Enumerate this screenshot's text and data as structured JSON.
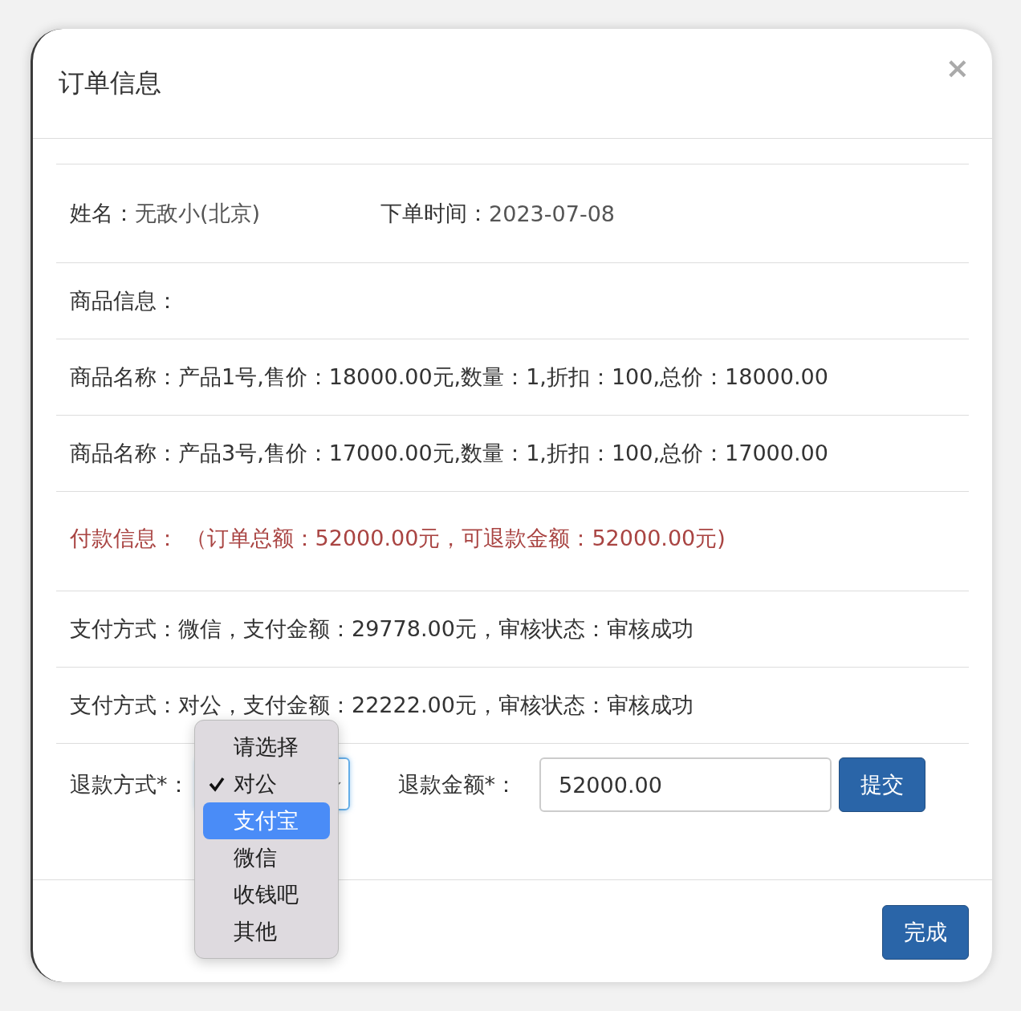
{
  "modal": {
    "title": "订单信息",
    "close": "×"
  },
  "customer": {
    "name_label": "姓名：",
    "name": "无敌小(北京)",
    "date_label": "下单时间：",
    "date": "2023-07-08"
  },
  "goods_heading": "商品信息：",
  "goods": [
    "商品名称：产品1号,售价：18000.00元,数量：1,折扣：100,总价：18000.00",
    "商品名称：产品3号,售价：17000.00元,数量：1,折扣：100,总价：17000.00"
  ],
  "payment_heading": "付款信息： （订单总额：52000.00元，可退款金额：52000.00元)",
  "payments": [
    "支付方式：微信，支付金额：29778.00元，审核状态：审核成功",
    "支付方式：对公，支付金额：22222.00元，审核状态：审核成功"
  ],
  "refund": {
    "method_label": "退款方式*：",
    "options": [
      {
        "label": "请选择",
        "checked": false,
        "selected": false
      },
      {
        "label": "对公",
        "checked": true,
        "selected": false
      },
      {
        "label": "支付宝",
        "checked": false,
        "selected": true
      },
      {
        "label": "微信",
        "checked": false,
        "selected": false
      },
      {
        "label": "收钱吧",
        "checked": false,
        "selected": false
      },
      {
        "label": "其他",
        "checked": false,
        "selected": false
      }
    ],
    "amount_label": "退款金额*：",
    "amount": "52000.00",
    "submit": "提交"
  },
  "footer": {
    "done": "完成"
  }
}
